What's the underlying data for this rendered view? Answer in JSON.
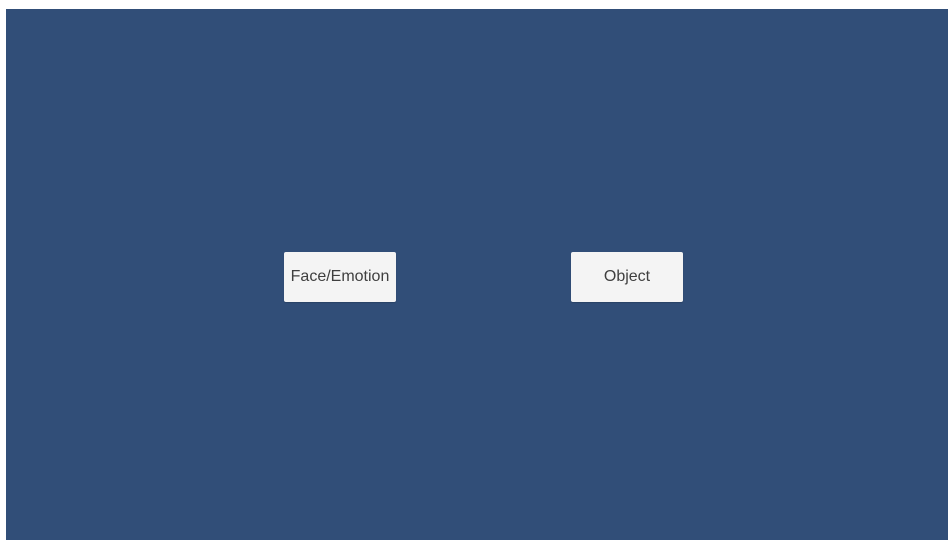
{
  "screen": {
    "background_color": "#314e78",
    "button_color": "#f4f4f4",
    "text_color": "#3f3f3f"
  },
  "buttons": {
    "face_emotion_label": "Face/Emotion",
    "object_label": "Object"
  }
}
